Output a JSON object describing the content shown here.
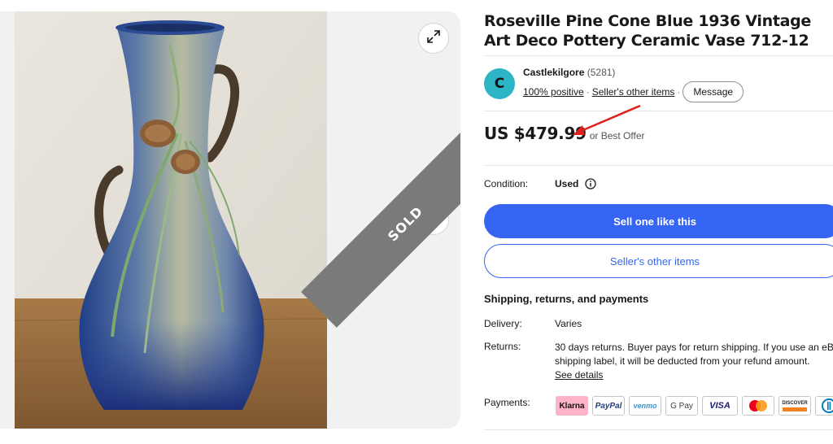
{
  "listing": {
    "title": "Roseville Pine Cone Blue 1936 Vintage Art Deco Pottery Ceramic Vase 712-12",
    "sold_badge": "SOLD"
  },
  "seller": {
    "initial": "C",
    "name": "Castlekilgore",
    "feedback_count": "(5281)",
    "positive": "100% positive",
    "other_items_link": "Seller's other items",
    "message_button": "Message"
  },
  "price": {
    "amount": "US $479.99",
    "best_offer": "or Best Offer"
  },
  "condition": {
    "label": "Condition:",
    "value": "Used"
  },
  "actions": {
    "sell_one": "Sell one like this",
    "seller_items": "Seller's other items"
  },
  "shipping": {
    "section_title": "Shipping, returns, and payments",
    "delivery_label": "Delivery:",
    "delivery_value": "Varies",
    "returns_label": "Returns:",
    "returns_line1": "30 days returns. Buyer pays for return shipping. If you use an eB",
    "returns_line2": "shipping label, it will be deducted from your refund amount.",
    "returns_link": "See details",
    "payments_label": "Payments:"
  },
  "payment_methods": [
    "Klarna",
    "PayPal",
    "venmo",
    "G Pay",
    "VISA",
    "mastercard",
    "DISCOVER",
    "diners"
  ],
  "colors": {
    "accent": "#3665f3",
    "avatar": "#2db5c6",
    "annotation_arrow": "#e0201a",
    "sold_ribbon": "#7a7a7a",
    "klarna": "#ffb3c7"
  },
  "icons": [
    "expand-icon",
    "chevron-right-icon",
    "info-icon"
  ]
}
